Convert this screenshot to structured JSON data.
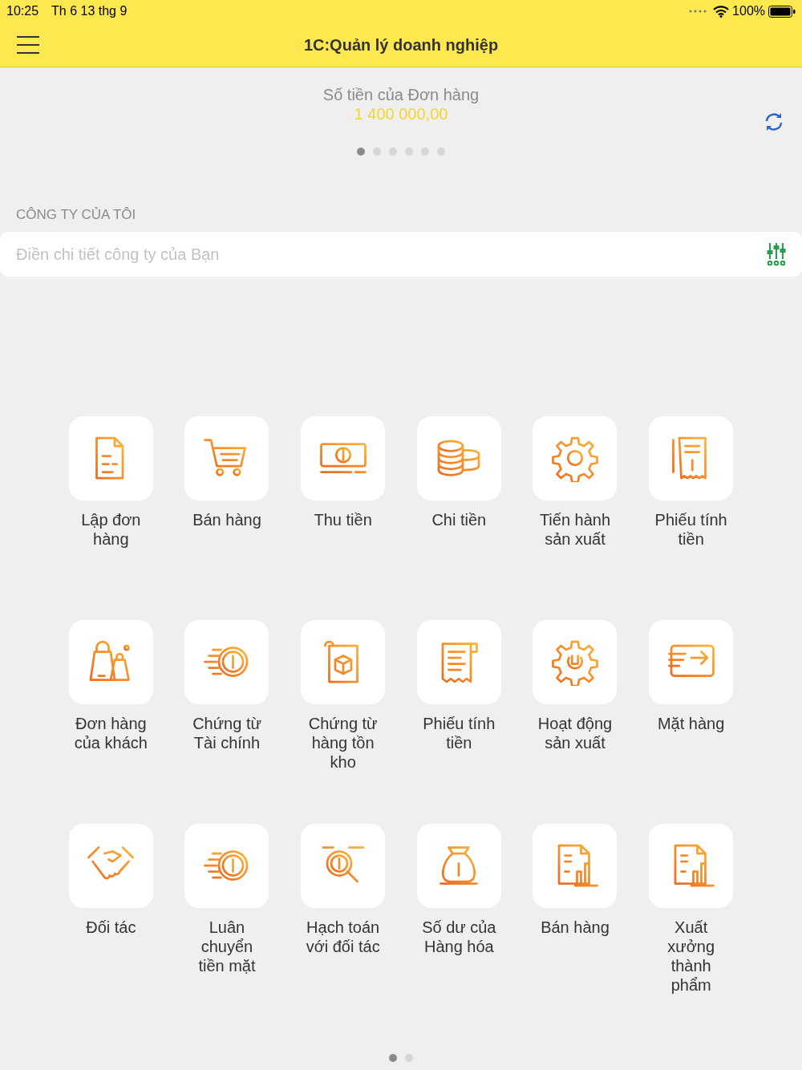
{
  "status_bar": {
    "time": "10:25",
    "date": "Th 6 13 thg 9",
    "battery": "100%"
  },
  "header": {
    "title": "1C:Quản lý doanh nghiệp"
  },
  "summary": {
    "label": "Số tiền của Đơn hàng",
    "value": "1 400 000,00",
    "pages": [
      {
        "selected": true
      },
      {
        "selected": false
      },
      {
        "selected": false
      },
      {
        "selected": false
      },
      {
        "selected": false
      },
      {
        "selected": false
      }
    ]
  },
  "company": {
    "section": "CÔNG TY CỦA TÔI",
    "placeholder": "Điền chi tiết công ty của Bạn"
  },
  "tiles": [
    {
      "label": "Lập đơn hàng"
    },
    {
      "label": "Bán hàng"
    },
    {
      "label": "Thu tiền"
    },
    {
      "label": "Chi tiền"
    },
    {
      "label": "Tiến hành sản xuất"
    },
    {
      "label": "Phiếu tính tiền"
    },
    {
      "label": "Đơn hàng của khách"
    },
    {
      "label": "Chứng từ Tài chính"
    },
    {
      "label": "Chứng từ hàng tồn kho"
    },
    {
      "label": "Phiếu tính tiền"
    },
    {
      "label": "Hoạt động sản xuất"
    },
    {
      "label": "Mặt hàng"
    },
    {
      "label": "Đối tác"
    },
    {
      "label": "Luân chuyển tiền mặt"
    },
    {
      "label": "Hạch toán với đối tác"
    },
    {
      "label": "Số dư của Hàng hóa"
    },
    {
      "label": "Bán hàng"
    },
    {
      "label": "Xuất xưởng thành phẩm"
    }
  ],
  "pages": [
    {
      "selected": true
    },
    {
      "selected": false
    }
  ]
}
